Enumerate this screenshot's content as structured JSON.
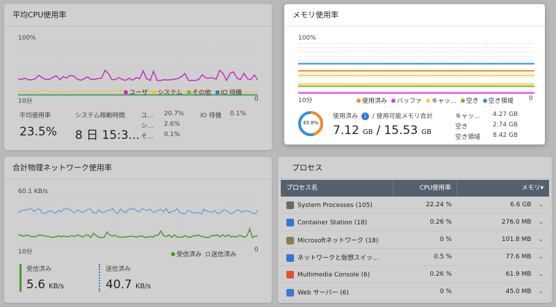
{
  "cpu": {
    "title": "平均CPU使用率",
    "y_max": "100%",
    "x_start": "10分",
    "x_end": "0",
    "legend": [
      {
        "label": "ユーザ",
        "color": "#c52bc6"
      },
      {
        "label": "システム",
        "color": "#f2c12e"
      },
      {
        "label": "その他",
        "color": "#74b72e"
      },
      {
        "label": "IO 待機",
        "color": "#2f79d4"
      }
    ],
    "avg_label": "平均使用率",
    "avg_value": "23.5%",
    "uptime_label": "システム稼動時間",
    "uptime_value": "8 日 15:3...",
    "breakdown": [
      {
        "label": "ユ...",
        "value": "20.7%"
      },
      {
        "label": "シ...",
        "value": "2.6%"
      },
      {
        "label": "そ...",
        "value": "0.1%"
      }
    ],
    "io_label": "IO 待機",
    "io_value": "0.1%"
  },
  "memory": {
    "title": "メモリ使用率",
    "y_max": "100%",
    "x_start": "10分",
    "x_end": "0",
    "legend": [
      {
        "label": "使用済み",
        "color": "#f28c28"
      },
      {
        "label": "バッファ",
        "color": "#d63be0"
      },
      {
        "label": "キャッ...",
        "color": "#f4d23a"
      },
      {
        "label": "空き",
        "color": "#74b72e"
      },
      {
        "label": "空き領域",
        "color": "#2f8fdd"
      }
    ],
    "percent": "45.8%",
    "percent_value": 0.458,
    "used_label": "使用済み",
    "available_label": "/ 使用可能メモリ合計",
    "used_value": "7.12",
    "used_unit": "GB",
    "total_value": "15.53",
    "total_unit": "GB",
    "details": [
      {
        "label": "キャッ...",
        "value": "4.27 GB"
      },
      {
        "label": "空き",
        "value": "2.74 GB"
      },
      {
        "label": "空き領域",
        "value": "8.42 GB"
      }
    ]
  },
  "network": {
    "title": "合計物理ネットワーク使用率",
    "y_max": "60.1 KB/s",
    "x_start": "10分",
    "x_end": "0",
    "legend": [
      {
        "label": "受信済み",
        "color": "#4c9a1f"
      },
      {
        "label": "送信済み",
        "color": "#2f79d4"
      }
    ],
    "rx_label": "受信済み",
    "rx_value": "5.6",
    "rx_unit": "KB/s",
    "tx_label": "送信済み",
    "tx_value": "40.7",
    "tx_unit": "KB/s"
  },
  "process": {
    "title": "プロセス",
    "columns": {
      "name": "プロセス名",
      "cpu": "CPU使用率",
      "mem": "メモリ"
    },
    "sort_indicator": "▾",
    "rows": [
      {
        "name": "System Processes (105)",
        "cpu": "22.24 %",
        "mem": "6.6 GB",
        "icon_color": "#6b6b6b"
      },
      {
        "name": "Container Station (18)",
        "cpu": "0.26 %",
        "mem": "276.0 MB",
        "icon_color": "#2f79d4"
      },
      {
        "name": "Microsoftネットワーク (18)",
        "cpu": "0 %",
        "mem": "101.8 MB",
        "icon_color": "#8a7a5a"
      },
      {
        "name": "ネットワークと仮想スイッ...",
        "cpu": "0.5 %",
        "mem": "77.6 MB",
        "icon_color": "#2f79d4"
      },
      {
        "name": "Multimedia Console (6)",
        "cpu": "0.26 %",
        "mem": "61.9 MB",
        "icon_color": "#e2532b"
      },
      {
        "name": "Web サーバー (6)",
        "cpu": "0 %",
        "mem": "45.0 MB",
        "icon_color": "#3a7bd5"
      }
    ]
  }
}
